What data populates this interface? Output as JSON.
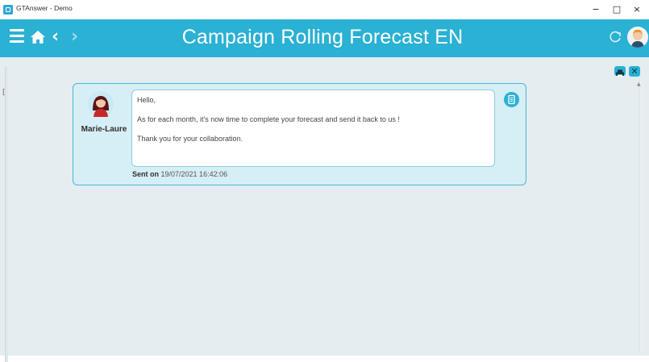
{
  "window": {
    "title": "GTAnswer - Demo",
    "controls": {
      "minimize": "−",
      "maximize": "□",
      "close": "×"
    }
  },
  "header": {
    "title": "Campaign Rolling Forecast EN",
    "accent_color": "#2ab1d4",
    "icons": [
      "menu-icon",
      "home-icon",
      "back-icon",
      "forward-icon",
      "refresh-icon",
      "user-avatar"
    ],
    "back_glyph": "‹",
    "forward_glyph": "›"
  },
  "toolbar": {
    "close_glyph": "✕",
    "icons": [
      "print-icon",
      "close-icon"
    ]
  },
  "message": {
    "sender": "Marie-Laure",
    "lines": [
      "Hello,",
      "As for each month, it's now time to complete your forecast and send it back to us !",
      "Thank you for your collaboration."
    ],
    "sent_label": "Sent on",
    "sent_date": "19/07/2021 16:42:06"
  },
  "left_mark": "["
}
